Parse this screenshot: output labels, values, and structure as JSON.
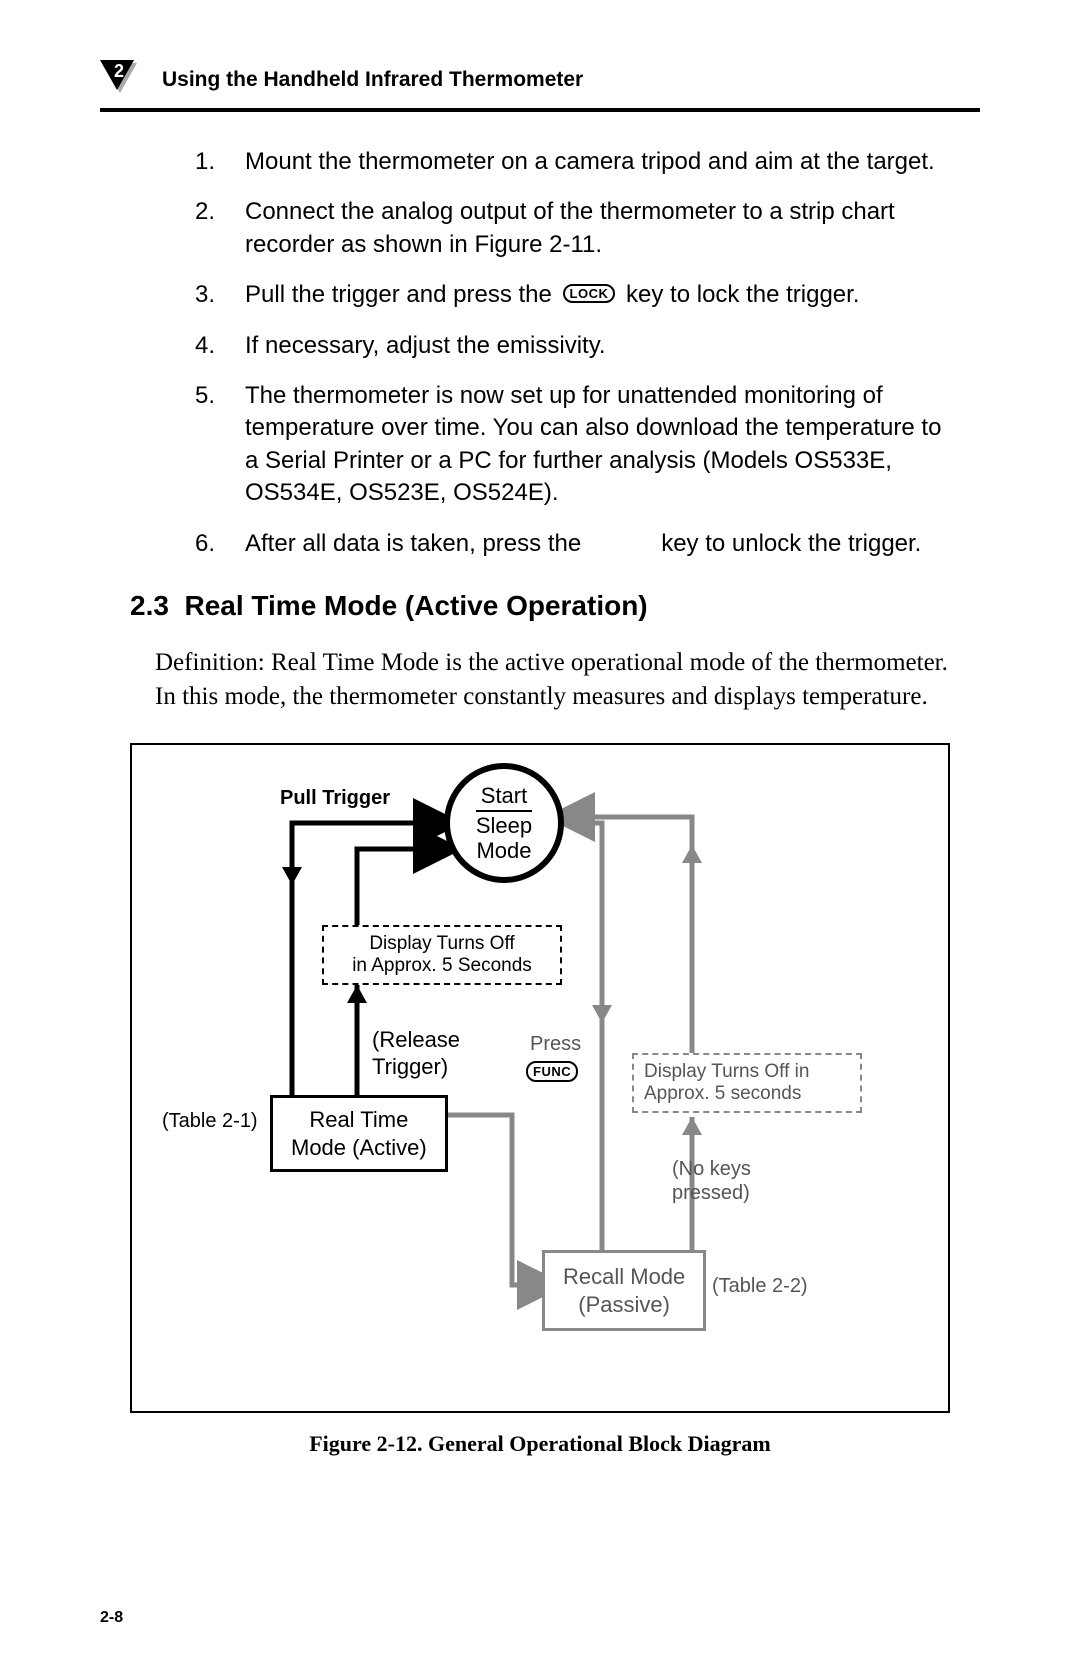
{
  "header": {
    "chapter_number": "2",
    "title": "Using the Handheld Infrared Thermometer"
  },
  "steps": [
    {
      "n": "1.",
      "text": "Mount the thermometer on a camera tripod and aim at the target."
    },
    {
      "n": "2.",
      "text": "Connect the analog output of the thermometer to a strip chart recorder as shown in Figure 2-11."
    },
    {
      "n": "3.",
      "pre": "Pull the trigger and press the ",
      "key": "LOCK",
      "post": " key to lock the trigger."
    },
    {
      "n": "4.",
      "text": "If necessary, adjust the emissivity."
    },
    {
      "n": "5.",
      "text": "The thermometer is now set up for unattended monitoring of temperature over time. You can also download the temperature to a Serial Printer or a PC for further analysis (Models OS533E, OS534E, OS523E, OS524E)."
    },
    {
      "n": "6.",
      "pre": "After all data is taken, press the ",
      "gap": "          ",
      "post": "key to unlock the trigger."
    }
  ],
  "section": {
    "number": "2.3",
    "title": "Real Time Mode (Active Operation)"
  },
  "definition": "Definition:  Real Time Mode is the active operational mode of the thermometer. In this mode, the thermometer constantly measures and displays temperature.",
  "diagram": {
    "pull_trigger": "Pull Trigger",
    "start": "Start",
    "sleep_mode_l1": "Sleep",
    "sleep_mode_l2": "Mode",
    "dashed1_l1": "Display Turns Off",
    "dashed1_l2": "in Approx. 5 Seconds",
    "release_l1": "(Release",
    "release_l2": "Trigger)",
    "table21": "(Table 2-1)",
    "realtime_l1": "Real Time",
    "realtime_l2": "Mode (Active)",
    "press": "Press",
    "func": "FUNC",
    "dashed2_l1": "Display Turns Off in",
    "dashed2_l2": "Approx. 5 seconds",
    "nokeys_l1": "(No keys",
    "nokeys_l2": "pressed)",
    "recall_l1": "Recall Mode",
    "recall_l2": "(Passive)",
    "table22": "(Table 2-2)"
  },
  "figure_caption": "Figure 2-12.  General Operational Block Diagram",
  "page_number": "2-8"
}
